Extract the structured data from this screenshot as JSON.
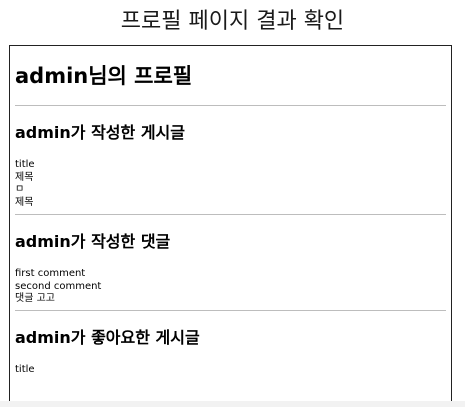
{
  "caption": "프로필 페이지 결과 확인",
  "profile": {
    "heading": "admin님의 프로필"
  },
  "sections": [
    {
      "title": "admin가 작성한 게시글",
      "items": [
        "title",
        "제목",
        "ㅁ",
        "제목"
      ]
    },
    {
      "title": "admin가 작성한 댓글",
      "items": [
        "first comment",
        "second comment",
        "댓글 고고"
      ]
    },
    {
      "title": "admin가 좋아요한 게시글",
      "items": [
        "title"
      ]
    }
  ]
}
